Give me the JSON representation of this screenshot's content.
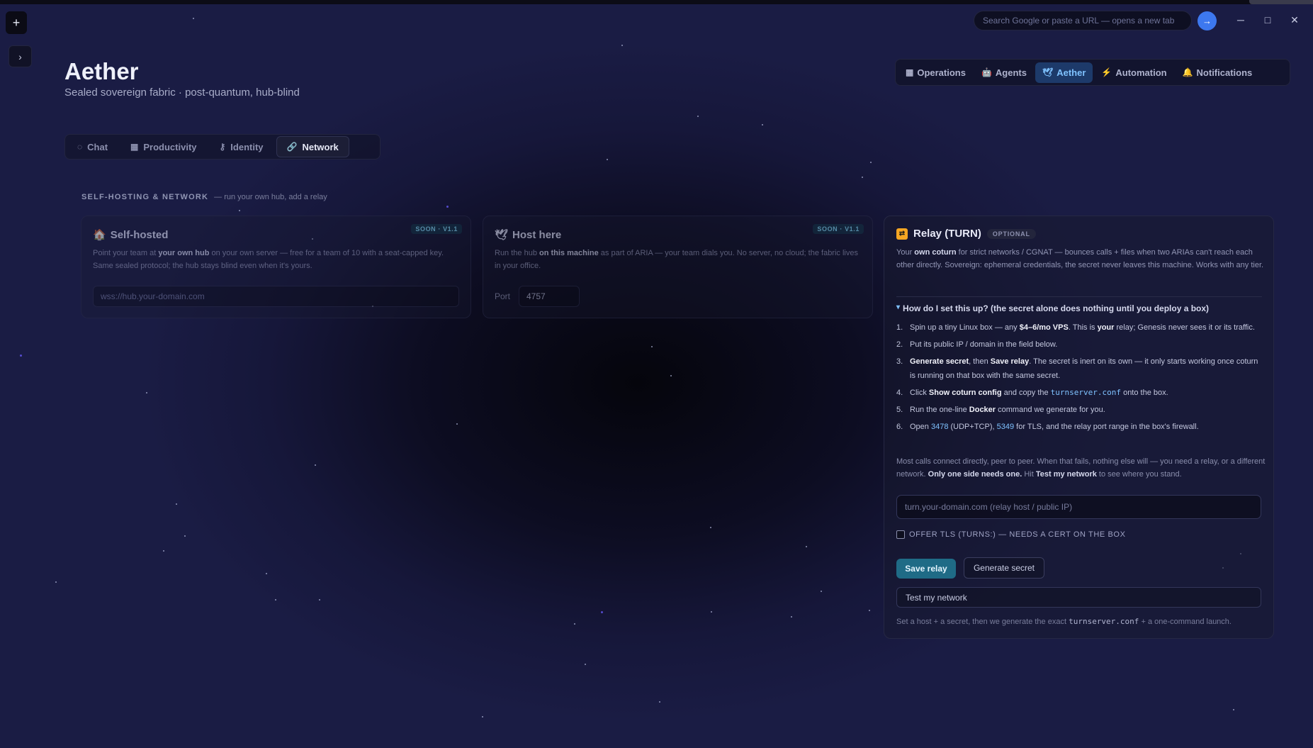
{
  "window": {
    "new_tab_label": "+",
    "sidebar_toggle_label": "›",
    "search_placeholder": "Search Google or paste a URL — opens a new tab",
    "go_label": "→",
    "minimize_label": "─",
    "maximize_label": "□",
    "close_label": "✕"
  },
  "app": {
    "title": "Aether",
    "subtitle": "Sealed sovereign fabric · post-quantum, hub-blind"
  },
  "top_nav": [
    {
      "icon": "grid-icon",
      "glyph": "▦",
      "label": "Operations",
      "active": false
    },
    {
      "icon": "robot-icon",
      "glyph": "🤖",
      "label": "Agents",
      "active": false
    },
    {
      "icon": "dove-icon",
      "glyph": "🕊",
      "label": "Aether",
      "active": true
    },
    {
      "icon": "bolt-icon",
      "glyph": "⚡",
      "label": "Automation",
      "active": false
    },
    {
      "icon": "bell-icon",
      "glyph": "🔔",
      "label": "Notifications",
      "active": false
    }
  ],
  "sub_tabs": [
    {
      "icon": "chat-bubble-icon",
      "glyph": "◌",
      "label": "Chat",
      "active": false
    },
    {
      "icon": "grid-icon",
      "glyph": "▦",
      "label": "Productivity",
      "active": false
    },
    {
      "icon": "key-icon",
      "glyph": "⚷",
      "label": "Identity",
      "active": false
    },
    {
      "icon": "link-icon",
      "glyph": "🔗",
      "label": "Network",
      "active": true
    }
  ],
  "section": {
    "title": "SELF-HOSTING & NETWORK",
    "desc": "— run your own hub, add a relay"
  },
  "self_hosted": {
    "icon_glyph": "🏠",
    "title": "Self-hosted",
    "badge": "SOON · V1.1",
    "desc_1": "Point your team at ",
    "desc_b": "your own hub",
    "desc_2": " on your own server — free for a team of 10 with a seat-capped key. Same sealed protocol; the hub stays blind even when it's yours.",
    "placeholder": "wss://hub.your-domain.com"
  },
  "host_here": {
    "icon_glyph": "🕊",
    "title": "Host here",
    "badge": "SOON · V1.1",
    "desc_1": "Run the hub ",
    "desc_b": "on this machine",
    "desc_2": " as part of ARIA — your team dials you. No server, no cloud; the fabric lives in your office.",
    "port_label": "Port",
    "port_value": "4757"
  },
  "relay": {
    "icon_glyph": "⇄",
    "title": "Relay (TURN)",
    "badge": "OPTIONAL",
    "desc_1": "Your ",
    "desc_b": "own coturn",
    "desc_2": " for strict networks / CGNAT — bounces calls + files when two ARIAs can't reach each other directly. Sovereign: ephemeral credentials, the secret never leaves this machine. Works with any tier.",
    "summary_arrow": "▾",
    "summary": "How do I set this up? (the secret alone does nothing until you deploy a box)",
    "steps": {
      "s1": {
        "n": "1.",
        "a": "Spin up a tiny Linux box — any ",
        "b1": "$4–6/mo VPS",
        "c": ". This is ",
        "b2": "your",
        "d": " relay; Genesis never sees it or its traffic."
      },
      "s2": {
        "n": "2.",
        "a": "Put its public IP / domain in the field below."
      },
      "s3": {
        "n": "3.",
        "b1": "Generate secret",
        "a": ", then ",
        "b2": "Save relay",
        "c": ". The secret is inert on its own — it only starts working once coturn is running on that box with the same secret."
      },
      "s4": {
        "n": "4.",
        "a": "Click ",
        "b1": "Show coturn config",
        "c": " and copy the ",
        "code": "turnserver.conf",
        "d": " onto the box."
      },
      "s5": {
        "n": "5.",
        "a": "Run the one-line ",
        "b1": "Docker",
        "c": " command we generate for you."
      },
      "s6": {
        "n": "6.",
        "a": "Open ",
        "p1": "3478",
        "c": " (UDP+TCP), ",
        "p2": "5349",
        "d": " for TLS, and the relay port range in the box's firewall."
      }
    },
    "note_1": "Most calls connect directly, peer to peer. When that fails, nothing else will — you need a relay, or a different network. ",
    "note_b1": "Only one side needs one.",
    "note_2": " Hit ",
    "note_b2": "Test my network",
    "note_3": " to see where you stand.",
    "host_placeholder": "turn.your-domain.com  (relay host / public IP)",
    "tls_label": "OFFER TLS (TURNS:) — NEEDS A CERT ON THE BOX",
    "save_label": "Save relay",
    "generate_label": "Generate secret",
    "test_label": "Test my network",
    "foot_1": "Set a host + a secret, then we generate the exact ",
    "foot_code": "turnserver.conf",
    "foot_2": " + a one-command launch."
  }
}
